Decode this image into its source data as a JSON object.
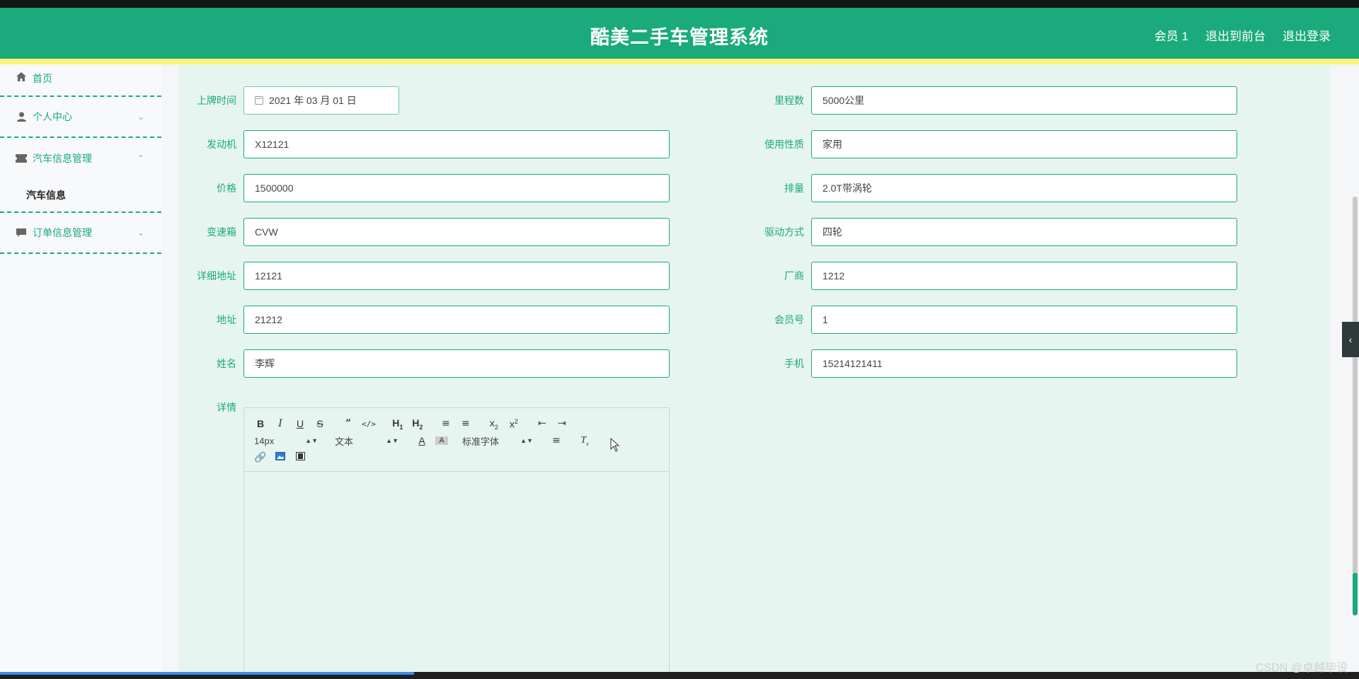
{
  "header": {
    "title": "酷美二手车管理系统",
    "links": [
      "会员 1",
      "退出到前台",
      "退出登录"
    ]
  },
  "sidebar": {
    "home": "首页",
    "personal": "个人中心",
    "car_mgmt": "汽车信息管理",
    "car_info": "汽车信息",
    "order_mgmt": "订单信息管理"
  },
  "form": {
    "left": [
      {
        "label": "上牌时间",
        "value": "2021 年 03 月 01 日"
      },
      {
        "label": "发动机",
        "value": "X12121"
      },
      {
        "label": "价格",
        "value": "1500000"
      },
      {
        "label": "变速箱",
        "value": "CVW"
      },
      {
        "label": "详细地址",
        "value": "12121"
      },
      {
        "label": "地址",
        "value": "21212"
      },
      {
        "label": "姓名",
        "value": "李辉"
      }
    ],
    "right": [
      {
        "label": "里程数",
        "value": "5000公里"
      },
      {
        "label": "使用性质",
        "value": "家用"
      },
      {
        "label": "排量",
        "value": "2.0T带涡轮"
      },
      {
        "label": "驱动方式",
        "value": "四轮"
      },
      {
        "label": "厂商",
        "value": "1212"
      },
      {
        "label": "会员号",
        "value": "1"
      },
      {
        "label": "手机",
        "value": "15214121411"
      }
    ],
    "detail_label": "详情"
  },
  "editor": {
    "font_size": "14px",
    "text_type": "文本",
    "font_family": "标准字体"
  },
  "watermark": "CSDN @卓越毕设"
}
